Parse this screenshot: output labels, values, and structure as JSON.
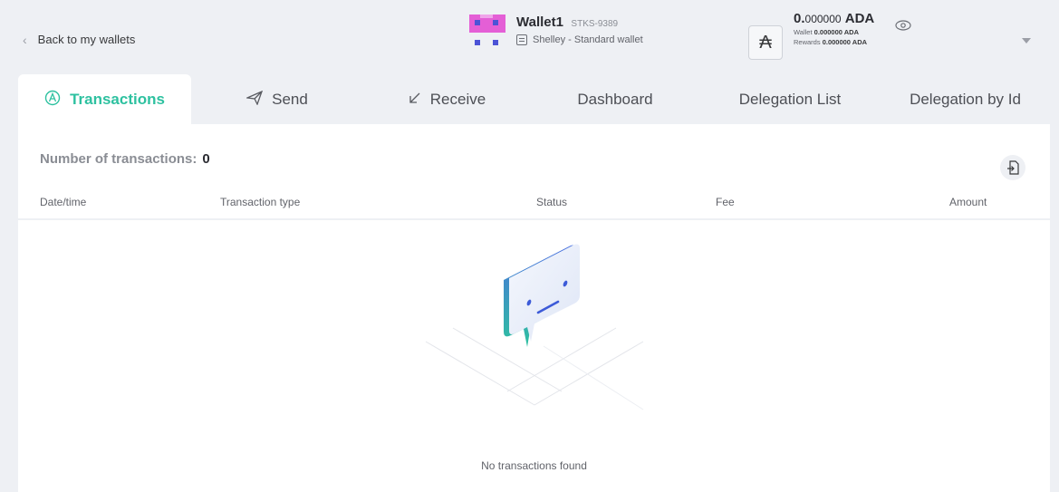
{
  "header": {
    "back_label": "Back to my wallets",
    "wallet_name": "Wallet1",
    "wallet_id": "STKS-9389",
    "wallet_type": "Shelley - Standard wallet",
    "total_int": "0.",
    "total_frac": "000000",
    "total_unit": "ADA",
    "wallet_label": "Wallet",
    "wallet_value": "0.000000 ADA",
    "rewards_label": "Rewards",
    "rewards_value": "0.000000 ADA",
    "ada_symbol": "₳"
  },
  "tabs": [
    {
      "label": "Transactions",
      "icon": "ada-circle-icon",
      "active": true
    },
    {
      "label": "Send",
      "icon": "paper-plane-icon",
      "active": false
    },
    {
      "label": "Receive",
      "icon": "arrow-down-left-icon",
      "active": false
    },
    {
      "label": "Dashboard",
      "icon": "",
      "active": false
    },
    {
      "label": "Delegation List",
      "icon": "",
      "active": false
    },
    {
      "label": "Delegation by Id",
      "icon": "",
      "active": false
    }
  ],
  "transactions": {
    "count_label": "Number of transactions:",
    "count_value": "0",
    "columns": [
      "Date/time",
      "Transaction type",
      "Status",
      "Fee",
      "Amount"
    ],
    "empty_message": "No transactions found"
  },
  "colors": {
    "accent": "#2ec1a0",
    "background": "#eef0f4",
    "panel": "#ffffff"
  }
}
